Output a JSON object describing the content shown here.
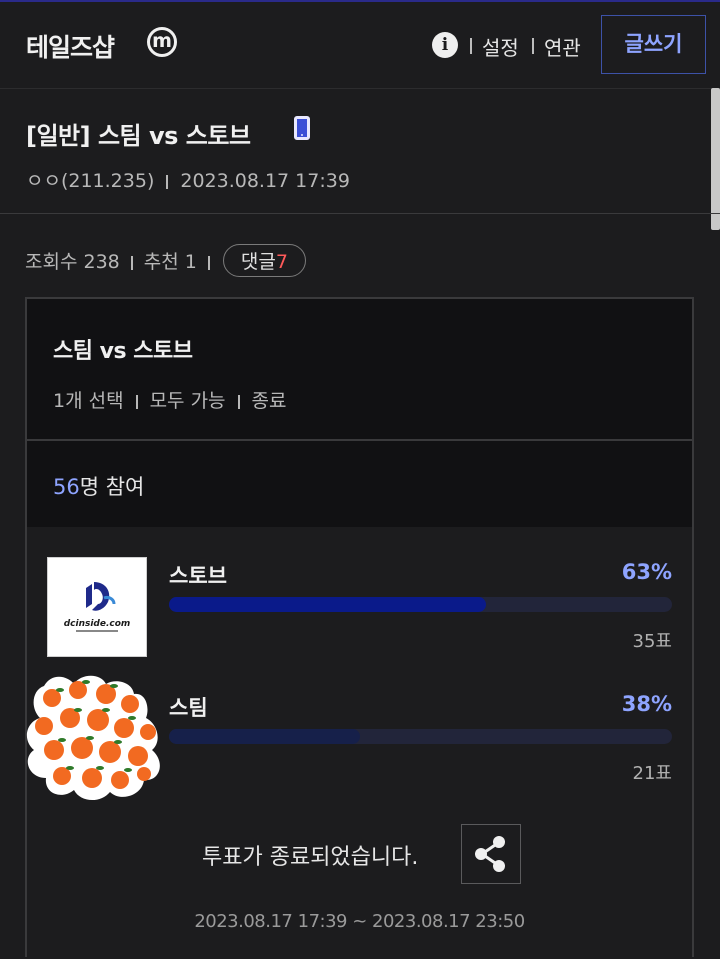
{
  "header": {
    "site_name": "테일즈샵",
    "m_badge": "m",
    "links": [
      "설정",
      "연관"
    ],
    "write_label": "글쓰기"
  },
  "post": {
    "title": "[일반] 스팀 vs 스토브",
    "author": "ㅇㅇ(211.235)",
    "datetime": "2023.08.17 17:39",
    "views": "조회수 238",
    "recommend": "추천 1",
    "comments_label": "댓글",
    "comments_count": "7"
  },
  "poll": {
    "title": "스팀 vs 스토브",
    "options": [
      "1개 선택",
      "모두 가능",
      "종료"
    ],
    "participants_num": "56",
    "participants_suffix": "명 참여",
    "items": [
      {
        "label": "스토브",
        "percent_text": "63%",
        "percent": 63,
        "votes": "35표",
        "color": "#0a1a8a"
      },
      {
        "label": "스팀",
        "percent_text": "38%",
        "percent": 38,
        "votes": "21표",
        "color": "#16204a"
      }
    ],
    "ended_text": "투표가 종료되었습니다.",
    "period": "2023.08.17 17:39 ~ 2023.08.17 23:50",
    "thumb_logo_text": "dcinside.com"
  },
  "colors": {
    "accent": "#8ea4ff",
    "comment_count": "#ff5a5a",
    "background": "#1c1c1e"
  }
}
